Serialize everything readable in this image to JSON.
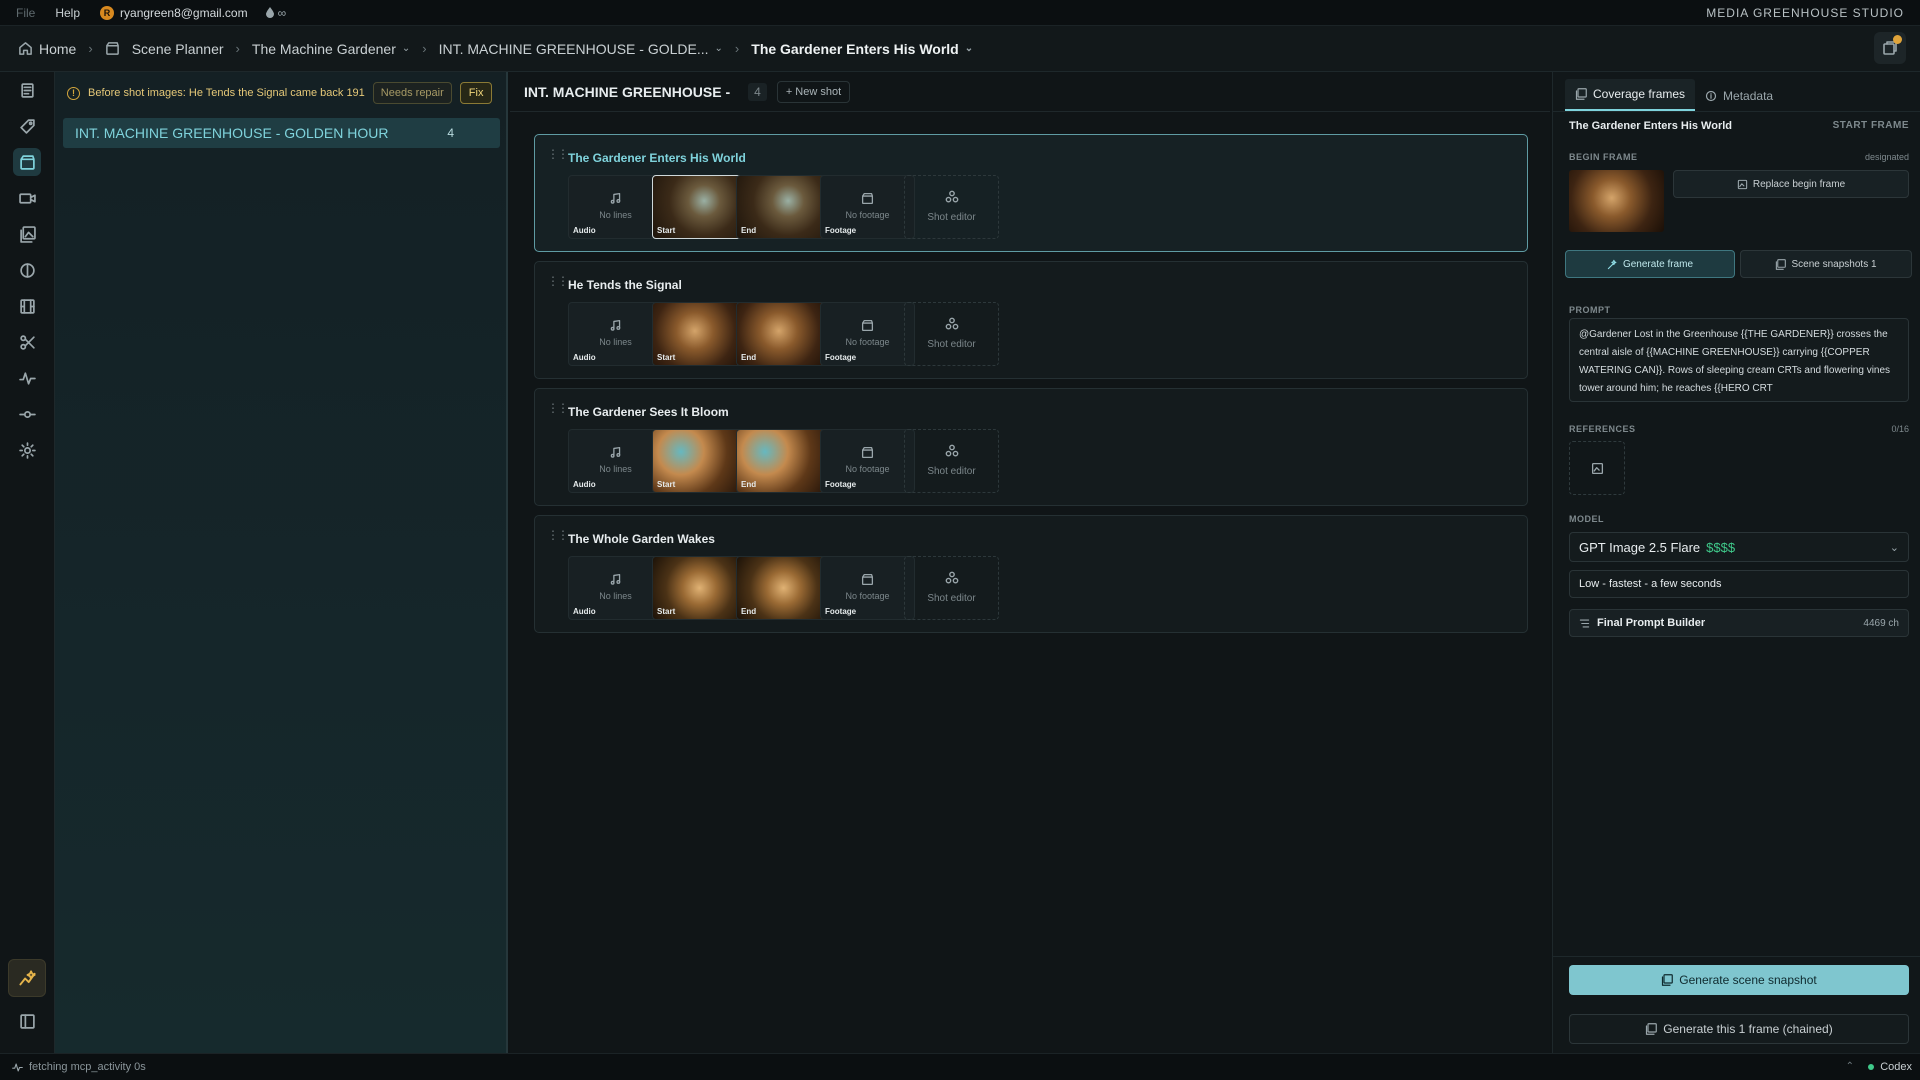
{
  "menubar": {
    "file": "File",
    "help": "Help",
    "avatar_letter": "R",
    "email": "ryangreen8@gmail.com",
    "infinity": "∞",
    "studio": "MEDIA GREENHOUSE STUDIO"
  },
  "breadcrumb": {
    "home": "Home",
    "scene_planner": "Scene Planner",
    "project": "The Machine Gardener",
    "location": "INT. MACHINE GREENHOUSE - GOLDE...",
    "shot": "The Gardener Enters His World"
  },
  "scene_panel": {
    "warning_text": "Before shot images: He Tends the Signal came back 191",
    "needs_repair": "Needs repair",
    "fix": "Fix",
    "scene_name": "INT. MACHINE GREENHOUSE - GOLDEN HOUR",
    "scene_count": "4"
  },
  "shots_panel": {
    "title": "INT. MACHINE GREENHOUSE -",
    "count": "4",
    "new_shot": "+ New shot",
    "slot_labels": {
      "audio": "Audio",
      "no_lines": "No lines",
      "start": "Start",
      "end": "End",
      "footage": "Footage",
      "no_footage": "No footage",
      "shot_editor": "Shot editor"
    },
    "shots": [
      {
        "title": "The Gardener Enters His World",
        "selected": true
      },
      {
        "title": "He Tends the Signal",
        "selected": false
      },
      {
        "title": "The Gardener Sees It Bloom",
        "selected": false
      },
      {
        "title": "The Whole Garden Wakes",
        "selected": false
      }
    ]
  },
  "right_panel": {
    "tab_coverage": "Coverage frames",
    "tab_metadata": "Metadata",
    "shot_title": "The Gardener Enters His World",
    "frame_kind": "START FRAME",
    "begin_frame_label": "BEGIN FRAME",
    "designated": "designated",
    "replace_begin": "Replace begin frame",
    "generate_frame": "Generate frame",
    "scene_snapshots": "Scene snapshots 1",
    "prompt_label": "PROMPT",
    "prompt_text": "@Gardener Lost in the Greenhouse {{THE GARDENER}} crosses the central aisle of {{MACHINE GREENHOUSE}} carrying {{COPPER WATERING CAN}}. Rows of sleeping cream CRTs and flowering vines tower around him; he reaches {{HERO CRT",
    "references_label": "REFERENCES",
    "references_count": "0/16",
    "model_label": "MODEL",
    "model_name": "GPT Image 2.5 Flare",
    "model_cost": "$$$$",
    "quality": "Low - fastest - a few seconds",
    "final_prompt_builder": "Final Prompt Builder",
    "char_count": "4469 ch",
    "generate_scene_snapshot": "Generate scene snapshot",
    "generate_chained": "Generate this 1 frame (chained)"
  },
  "statusbar": {
    "activity": "fetching mcp_activity 0s",
    "codex": "Codex"
  },
  "colors": {
    "accent": "#7fd3dc",
    "warning": "#e5c878",
    "money": "#3fc98a"
  }
}
